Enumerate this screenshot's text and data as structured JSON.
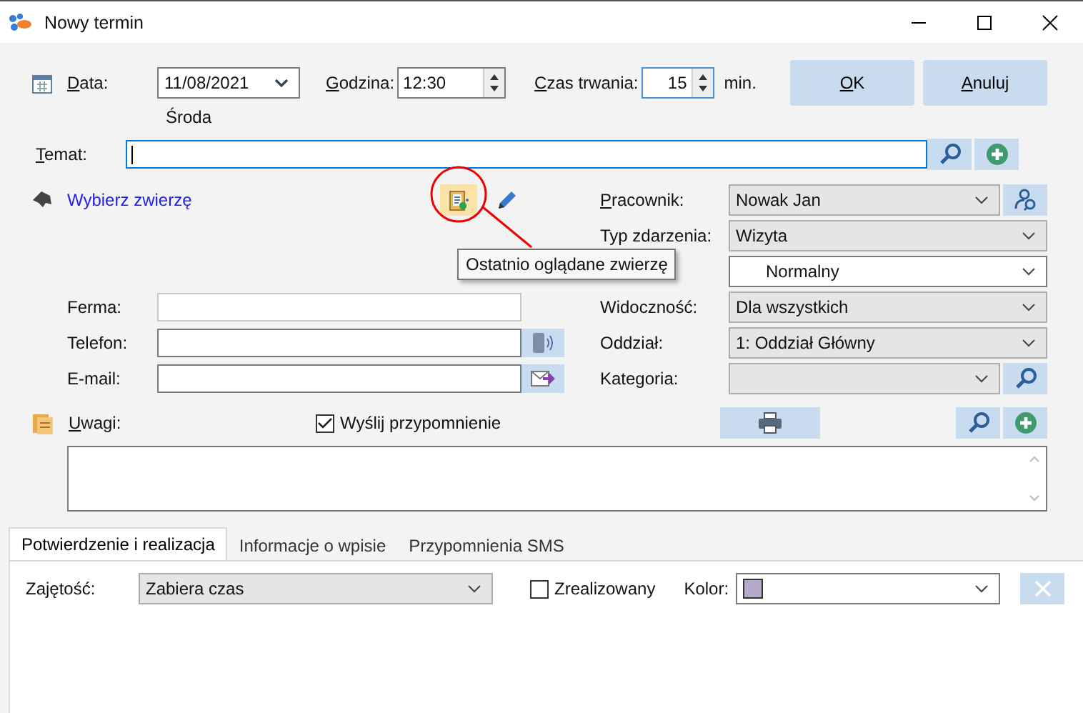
{
  "window": {
    "title": "Nowy termin"
  },
  "date": {
    "label": "Data:",
    "value": "11/08/2021",
    "weekday": "Środa"
  },
  "time": {
    "label": "Godzina:",
    "value": "12:30"
  },
  "duration": {
    "label": "Czas trwania:",
    "value": "15",
    "unit": "min."
  },
  "buttons": [
    {
      "label": "OK"
    },
    {
      "label": "Anuluj"
    }
  ],
  "subject": {
    "label": "Temat:"
  },
  "animal_link": "Wybierz zwierzę",
  "contact_fields": [
    {
      "label": "Ferma:",
      "kind": "plain"
    },
    {
      "label": "Telefon:",
      "kind": "phone"
    },
    {
      "label": "E-mail:",
      "kind": "email"
    }
  ],
  "right_fields": [
    {
      "label": "Pracownik:",
      "value": "Nowak Jan",
      "kind": "employee"
    },
    {
      "label": "Typ zdarzenia:",
      "value": "Wizyta",
      "kind": "select"
    },
    {
      "value": "Normalny",
      "kind": "priority"
    },
    {
      "label": "Widoczność:",
      "value": "Dla wszystkich",
      "kind": "select"
    },
    {
      "label": "Oddział:",
      "value": "1: Oddział Główny",
      "kind": "select"
    },
    {
      "label": "Kategoria:",
      "kind": "search"
    }
  ],
  "notes": {
    "label": "Uwagi:"
  },
  "reminder": {
    "label": "Wyślij przypomnienie",
    "checked": true
  },
  "tooltip": "Ostatnio oglądane zwierzę",
  "tabs": [
    {
      "label": "Potwierdzenie i realizacja",
      "selected": true
    },
    {
      "label": "Informacje o wpisie",
      "selected": false
    },
    {
      "label": "Przypomnienia SMS",
      "selected": false
    }
  ],
  "tab_panel": {
    "busy": {
      "label": "Zajętość:",
      "value": "Zabiera czas"
    },
    "realized": {
      "label": "Zrealizowany",
      "checked": false
    },
    "color": {
      "label": "Kolor:",
      "color": "#b6a8c9"
    }
  }
}
